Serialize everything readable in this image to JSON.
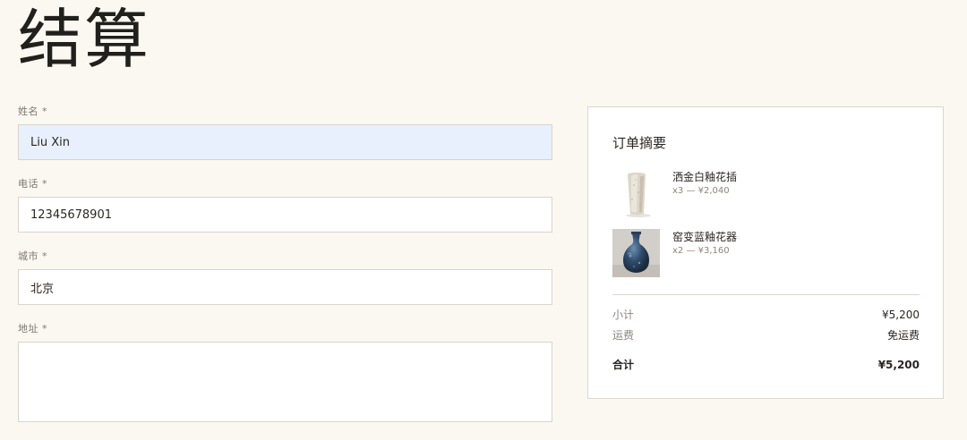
{
  "page": {
    "title": "结算"
  },
  "form": {
    "name": {
      "label": "姓名",
      "required_mark": "*",
      "value": "Liu Xin"
    },
    "phone": {
      "label": "电话",
      "required_mark": "*",
      "value": "12345678901"
    },
    "city": {
      "label": "城市",
      "required_mark": "*",
      "value": "北京"
    },
    "address": {
      "label": "地址",
      "required_mark": "*",
      "value": ""
    }
  },
  "summary": {
    "title": "订单摘要",
    "items": [
      {
        "name": "洒金白釉花插",
        "meta": "x3 — ¥2,040",
        "icon": "white-vase-thumbnail"
      },
      {
        "name": "窑变蓝釉花器",
        "meta": "x2 — ¥3,160",
        "icon": "blue-vase-thumbnail"
      }
    ],
    "subtotal": {
      "label": "小计",
      "value": "¥5,200"
    },
    "shipping": {
      "label": "运费",
      "value": "免运费"
    },
    "total": {
      "label": "合计",
      "value": "¥5,200"
    }
  },
  "colors": {
    "background": "#fbf8f2",
    "autofill": "#e8f0fe",
    "border": "#d9d4cc",
    "text": "#2a2723",
    "muted": "#8c867e"
  }
}
